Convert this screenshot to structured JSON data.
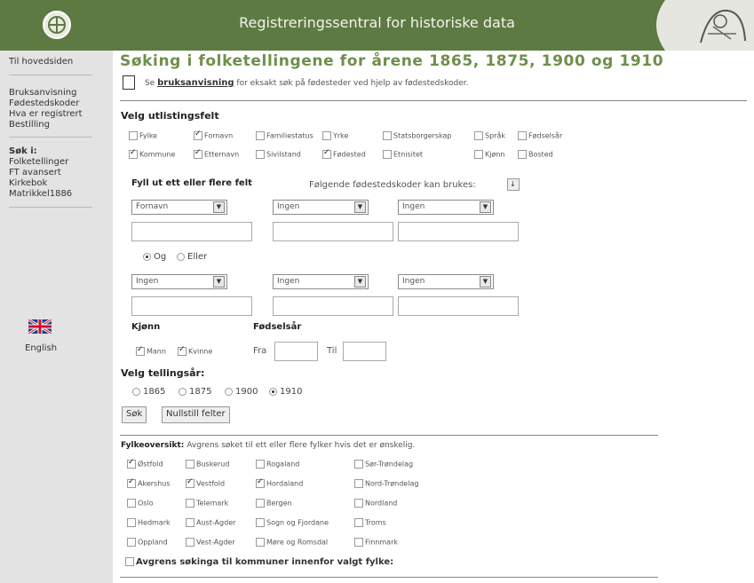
{
  "header": {
    "site_title": "Registreringssentral for historiske data"
  },
  "sidebar": {
    "home": "Til hovedsiden",
    "items1": [
      "Bruksanvisning",
      "Fødestedskoder",
      "Hva er registrert",
      "Bestilling"
    ],
    "search_label": "Søk i:",
    "items2": [
      "Folketellinger",
      "FT avansert",
      "Kirkebok",
      "Matrikkel1886"
    ],
    "english": "English"
  },
  "page": {
    "title": "Søking i folketellingene for årene 1865, 1875, 1900 og 1910",
    "manual_pre": "Se",
    "manual_link": "bruksanvisning",
    "manual_post": "for eksakt søk på fødesteder ved hjelp av fødestedskoder."
  },
  "listing": {
    "label": "Velg utlistingsfelt",
    "row1": [
      {
        "label": "Fylke",
        "checked": false
      },
      {
        "label": "Fornavn",
        "checked": true
      },
      {
        "label": "Familiestatus",
        "checked": false
      },
      {
        "label": "Yrke",
        "checked": false
      },
      {
        "label": "Statsborgerskap",
        "checked": false
      },
      {
        "label": "Språk",
        "checked": false
      },
      {
        "label": "Fødselsår",
        "checked": false
      }
    ],
    "row2": [
      {
        "label": "Kommune",
        "checked": true
      },
      {
        "label": "Etternavn",
        "checked": true
      },
      {
        "label": "Sivilstand",
        "checked": false
      },
      {
        "label": "Fødested",
        "checked": true
      },
      {
        "label": "Etnisitet",
        "checked": false
      },
      {
        "label": "Kjønn",
        "checked": false
      },
      {
        "label": "Bosted",
        "checked": false
      }
    ]
  },
  "fields": {
    "label": "Fyll ut ett eller flere felt",
    "codes_label": "Følgende fødestedskoder kan brukes:",
    "selects_row1": [
      "Fornavn",
      "Ingen",
      "Ingen"
    ],
    "selects_row2": [
      "Ingen",
      "Ingen",
      "Ingen"
    ],
    "and_label": "Og",
    "or_label": "Eller"
  },
  "gender": {
    "label": "Kjønn",
    "male": "Mann",
    "female": "Kvinne"
  },
  "birthyear": {
    "label": "Fødselsår",
    "from": "Fra",
    "to": "Til"
  },
  "census": {
    "label": "Velg tellingsår:",
    "years": [
      "1865",
      "1875",
      "1900",
      "1910"
    ],
    "selected": "1910"
  },
  "buttons": {
    "search": "Søk",
    "reset": "Nullstill felter"
  },
  "county": {
    "label": "Fylkeoversikt:",
    "desc": "Avgrens søket til ett eller flere fylker hvis det er ønskelig.",
    "cols": [
      [
        {
          "label": "Østfold",
          "checked": true
        },
        {
          "label": "Akershus",
          "checked": true
        },
        {
          "label": "Oslo",
          "checked": false
        },
        {
          "label": "Hedmark",
          "checked": false
        },
        {
          "label": "Oppland",
          "checked": false
        }
      ],
      [
        {
          "label": "Buskerud",
          "checked": false
        },
        {
          "label": "Vestfold",
          "checked": true
        },
        {
          "label": "Telemark",
          "checked": false
        },
        {
          "label": "Aust-Agder",
          "checked": false
        },
        {
          "label": "Vest-Agder",
          "checked": false
        }
      ],
      [
        {
          "label": "Rogaland",
          "checked": false
        },
        {
          "label": "Hordaland",
          "checked": true
        },
        {
          "label": "Bergen",
          "checked": false
        },
        {
          "label": "Sogn og Fjordane",
          "checked": false
        },
        {
          "label": "Møre og Romsdal",
          "checked": false
        }
      ],
      [
        {
          "label": "Sør-Trøndelag",
          "checked": false
        },
        {
          "label": "Nord-Trøndelag",
          "checked": false
        },
        {
          "label": "Nordland",
          "checked": false
        },
        {
          "label": "Troms",
          "checked": false
        },
        {
          "label": "Finnmark",
          "checked": false
        }
      ]
    ],
    "restrict": "Avgrens søkinga til kommuner innenfor valgt fylke:"
  }
}
